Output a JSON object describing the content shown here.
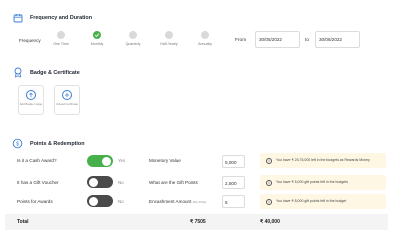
{
  "frequency": {
    "title": "Frequency and Duration",
    "label": "Frequency",
    "options": [
      {
        "label": "One Time",
        "active": false
      },
      {
        "label": "Monthly",
        "active": true
      },
      {
        "label": "Quarterly",
        "active": false
      },
      {
        "label": "Half-Yearly",
        "active": false
      },
      {
        "label": "Annually",
        "active": false
      }
    ],
    "from_label": "From",
    "from_value": "30/05/2022",
    "to_label": "to",
    "to_value": "30/06/2022"
  },
  "badge": {
    "title": "Badge & Certificate",
    "add_badge": "Add Badge Image",
    "upload_cert": "Upload Certificate"
  },
  "points": {
    "title": "Points & Redemption",
    "rows": [
      {
        "question": "Is it a Cash Award?",
        "toggle_on": true,
        "toggle_text": "Yes",
        "field_label": "Monetory Value",
        "field_suffix": "",
        "value": "5,000",
        "info": "You have ₹ 25,75,000 left in the budgets as Rewards Money"
      },
      {
        "question": "It has a Gift Voucher",
        "toggle_on": false,
        "toggle_text": "No",
        "field_label": "What are the Gift Points",
        "field_suffix": "",
        "value": "2,500",
        "info": "You have ₹ 5,000 gift points left in the budgets"
      },
      {
        "question": "Points for Awards",
        "toggle_on": false,
        "toggle_text": "No",
        "field_label": "Encashment Amount",
        "field_suffix": "(Per Point)",
        "value": "5",
        "info": "You have ₹ 8,000 gift points left in the budget"
      }
    ]
  },
  "total": {
    "label": "Total",
    "value1": "₹ 7505",
    "value2": "₹ 40,000"
  },
  "colors": {
    "accent_green": "#47b04b",
    "accent_blue": "#3a7bd5",
    "info_bg": "#fdf7e3"
  }
}
